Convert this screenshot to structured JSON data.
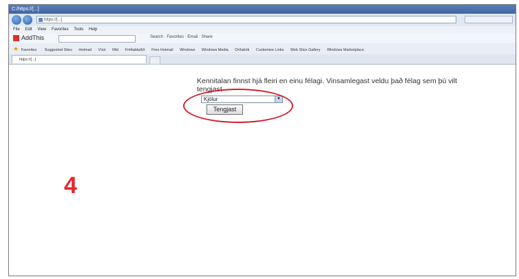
{
  "window": {
    "title": "C:/https://[...]",
    "address": "https://[...]"
  },
  "menubar": [
    "File",
    "Edit",
    "View",
    "Favorites",
    "Tools",
    "Help"
  ],
  "addthis_toolbar": {
    "label": "AddThis",
    "tools": "Search · Favorites · Email · Share"
  },
  "favorites_bar": {
    "label": "Favorites",
    "items": [
      "Suggested Sites",
      "Hotmail",
      "Vísir",
      "Mbl",
      "Fréttablaðið",
      "Free Hotmail",
      "Windows",
      "Windows Media",
      "Orðabók",
      "Customize Links",
      "Web Slice Gallery",
      "Windows Marketplace"
    ]
  },
  "tab": {
    "label": "https://[...]"
  },
  "page": {
    "message": "Kennitalan finnst hjá fleiri en einu félagi. Vinsamlegast veldu það félag sem þú vilt tengjast",
    "select_value": "Kjölur",
    "connect_label": "Tengjast"
  },
  "annotation": {
    "step_number": "4",
    "color": "#e5262f"
  }
}
